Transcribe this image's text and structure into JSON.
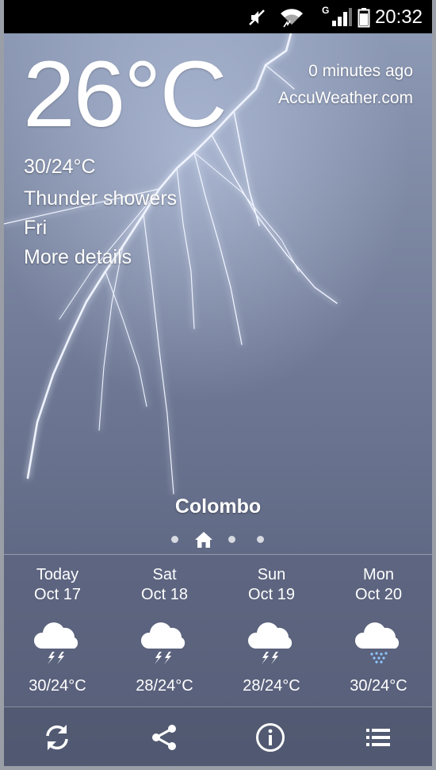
{
  "status_bar": {
    "time": "20:32",
    "network_type": "G",
    "icons": [
      "mute-icon",
      "wifi-icon",
      "signal-icon",
      "battery-icon"
    ]
  },
  "current": {
    "temperature": "26°C",
    "range": "30/24°C",
    "condition": "Thunder showers",
    "day": "Fri",
    "details_link": "More details",
    "updated": "0 minutes ago",
    "source": "AccuWeather.com"
  },
  "location": {
    "city": "Colombo",
    "page_count": 4,
    "active_page": 1
  },
  "forecast": [
    {
      "day": "Today",
      "date": "Oct 17",
      "temp": "30/24°C",
      "icon": "thunder-cloud-icon"
    },
    {
      "day": "Sat",
      "date": "Oct 18",
      "temp": "28/24°C",
      "icon": "thunder-cloud-icon"
    },
    {
      "day": "Sun",
      "date": "Oct 19",
      "temp": "28/24°C",
      "icon": "thunder-cloud-icon"
    },
    {
      "day": "Mon",
      "date": "Oct 20",
      "temp": "30/24°C",
      "icon": "rain-cloud-icon"
    }
  ],
  "toolbar": {
    "buttons": [
      "refresh-icon",
      "share-icon",
      "info-icon",
      "menu-list-icon"
    ]
  },
  "colors": {
    "status_bar": "#000000",
    "sky_top": "#8f9cb8",
    "sky_bottom": "#555d77",
    "lightning": "#e8f0ff",
    "rain": "#8ec7ff"
  }
}
